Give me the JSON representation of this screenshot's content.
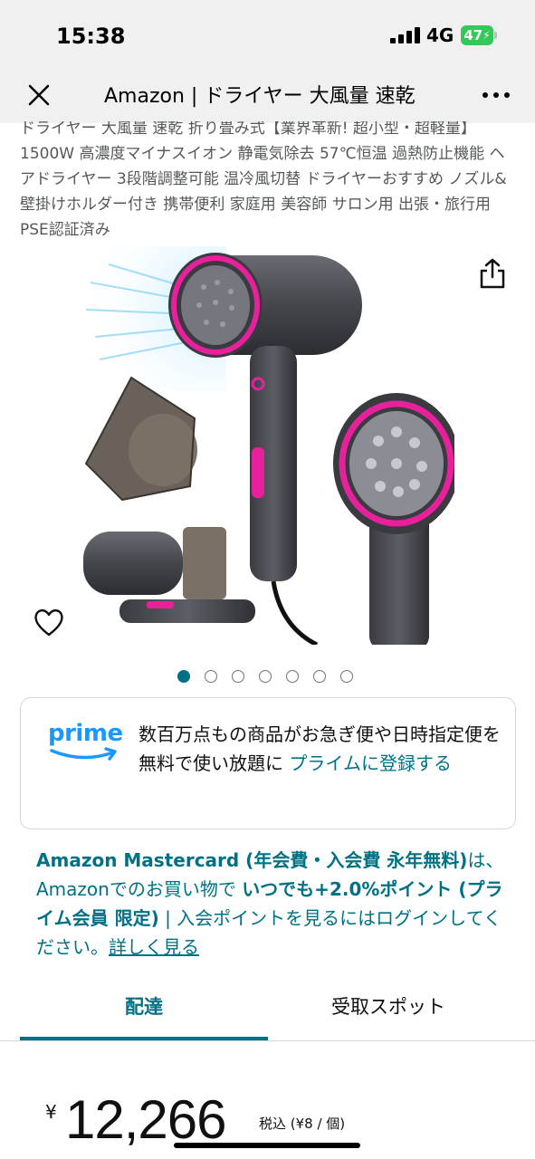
{
  "status_bar": {
    "time": "15:38",
    "network": "4G",
    "battery": "47"
  },
  "browser": {
    "title": "Amazon | ドライヤー 大風量 速乾",
    "close_icon": "close-icon",
    "more_icon": "more-icon"
  },
  "product": {
    "title": "ドライヤー 大風量 速乾 折り畳み式【業界革新! 超小型・超軽量】1500W 高濃度マイナスイオン 静電気除去 57℃恒温 過熱防止機能 ヘアドライヤー 3段階調整可能 温冷風切替 ドライヤーおすすめ ノズル&壁掛けホルダー付き 携帯便利 家庭用 美容師 サロン用 出張・旅行用 PSE認証済み",
    "image_count": 7,
    "active_image": 1
  },
  "prime": {
    "logo": "prime",
    "text": "数百万点もの商品がお急ぎ便や日時指定便を無料で使い放題に ",
    "link": "プライムに登録する"
  },
  "mastercard": {
    "bold1": "Amazon Mastercard (年会費・入会費 永年無料)",
    "text1": "は、Amazonでのお買い物で ",
    "bold2": "いつでも+2.0%ポイント (プライム会員 限定)",
    "text2": " | 入会ポイントを見るにはログインしてください。",
    "link": "詳しく見る"
  },
  "tabs": {
    "delivery": "配達",
    "pickup": "受取スポット"
  },
  "price": {
    "symbol": "¥",
    "value": "12,266",
    "unit": "税込 (¥8 / 個)"
  },
  "colors": {
    "accent": "#007185",
    "prime_blue": "#1a98ff",
    "battery_green": "#34c759"
  }
}
